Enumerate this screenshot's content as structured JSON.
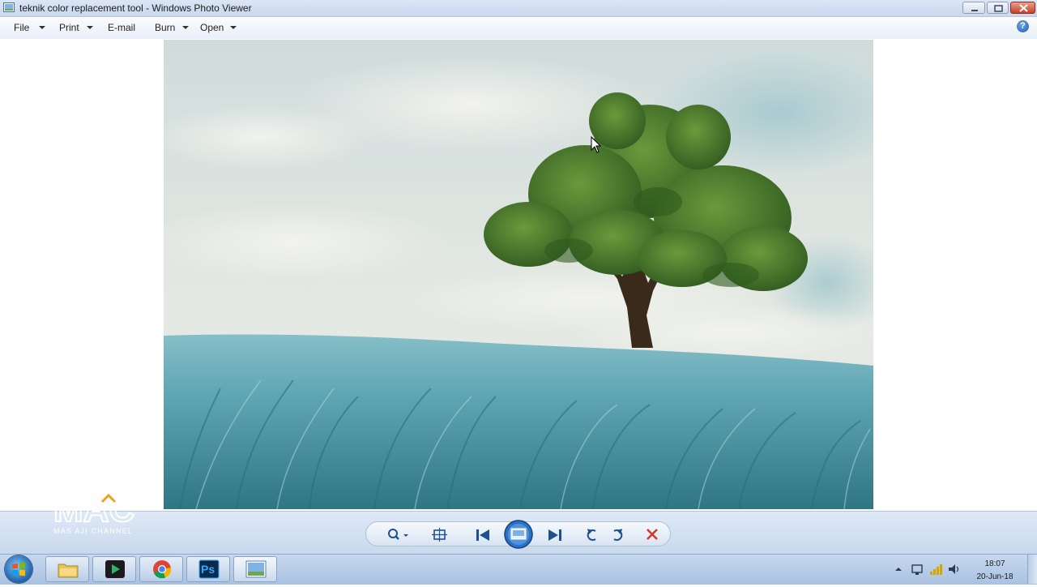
{
  "window": {
    "title": "teknik color replacement tool - Windows Photo Viewer",
    "app_icon": "photo-viewer-icon",
    "controls": [
      "minimize-icon",
      "maximize-icon",
      "close-icon"
    ]
  },
  "menubar": {
    "items": [
      {
        "label": "File",
        "has_dropdown": true
      },
      {
        "label": "Print",
        "has_dropdown": true
      },
      {
        "label": "E-mail",
        "has_dropdown": false
      },
      {
        "label": "Burn",
        "has_dropdown": true
      },
      {
        "label": "Open",
        "has_dropdown": true
      }
    ],
    "help_icon": "help-icon",
    "help_glyph": "?"
  },
  "photo": {
    "subject": "lone tree on a hill with teal grass field under a cloudy sky",
    "colors": {
      "sky": "#dfe6e3",
      "grass": "#5fa5b3",
      "foliage": "#4e7f2f",
      "trunk": "#3a2a1a"
    }
  },
  "controls": {
    "buttons": [
      "zoom-icon",
      "actual-size-icon",
      "previous-icon",
      "slideshow-icon",
      "next-icon",
      "rotate-counterclockwise-icon",
      "rotate-clockwise-icon",
      "delete-icon"
    ]
  },
  "watermark": {
    "logo": "MAC",
    "tagline": "MAS AJI CHANNEL"
  },
  "taskbar": {
    "start_icon": "windows-start-icon",
    "apps": [
      "file-explorer-icon",
      "video-editor-icon",
      "chrome-icon",
      "photoshop-icon",
      "photo-viewer-icon"
    ],
    "photoshop_label": "Ps",
    "tray_icons": [
      "show-hidden-icons-arrow",
      "network-icon",
      "signal-icon",
      "volume-icon"
    ],
    "time": "18:07",
    "date": "20-Jun-18"
  },
  "colors": {
    "titlebar": "#c9d8ee",
    "controlbar": "#d4e1f1",
    "taskbar": "#b8cce6",
    "close_red": "#d13b25"
  }
}
